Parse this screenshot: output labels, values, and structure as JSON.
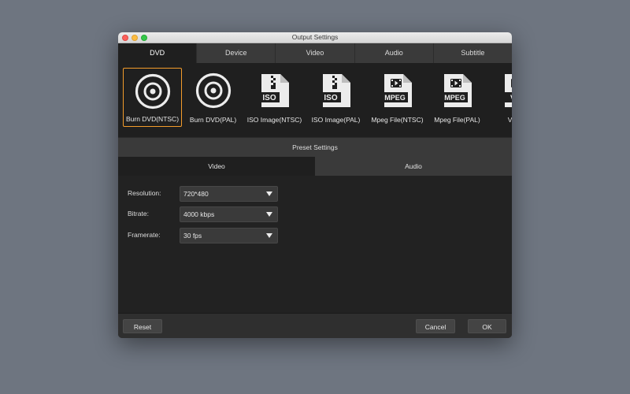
{
  "window": {
    "title": "Output Settings"
  },
  "tabs": [
    {
      "label": "DVD",
      "active": true
    },
    {
      "label": "Device",
      "active": false
    },
    {
      "label": "Video",
      "active": false
    },
    {
      "label": "Audio",
      "active": false
    },
    {
      "label": "Subtitle",
      "active": false
    }
  ],
  "formats": [
    {
      "label": "Burn DVD(NTSC)",
      "icon": "disc-icon",
      "selected": true
    },
    {
      "label": "Burn DVD(PAL)",
      "icon": "disc-icon",
      "selected": false
    },
    {
      "label": "ISO Image(NTSC)",
      "icon": "iso-file-icon",
      "badge": "ISO",
      "selected": false
    },
    {
      "label": "ISO Image(PAL)",
      "icon": "iso-file-icon",
      "badge": "ISO",
      "selected": false
    },
    {
      "label": "Mpeg File(NTSC)",
      "icon": "mpeg-file-icon",
      "badge": "MPEG",
      "selected": false
    },
    {
      "label": "Mpeg File(PAL)",
      "icon": "mpeg-file-icon",
      "badge": "MPEG",
      "selected": false
    },
    {
      "label": "VOB F",
      "icon": "vob-file-icon",
      "badge": "VO",
      "selected": false
    }
  ],
  "preset": {
    "header": "Preset Settings",
    "subtabs": [
      {
        "label": "Video",
        "active": true
      },
      {
        "label": "Audio",
        "active": false
      }
    ],
    "fields": [
      {
        "label": "Resolution:",
        "value": "720*480"
      },
      {
        "label": "Bitrate:",
        "value": "4000 kbps"
      },
      {
        "label": "Framerate:",
        "value": "30 fps"
      }
    ]
  },
  "footer": {
    "reset_label": "Reset",
    "cancel_label": "Cancel",
    "ok_label": "OK"
  },
  "colors": {
    "selection_accent": "#f39c2b",
    "window_bg": "#2a2a2a",
    "desktop_bg": "#6e7580"
  }
}
